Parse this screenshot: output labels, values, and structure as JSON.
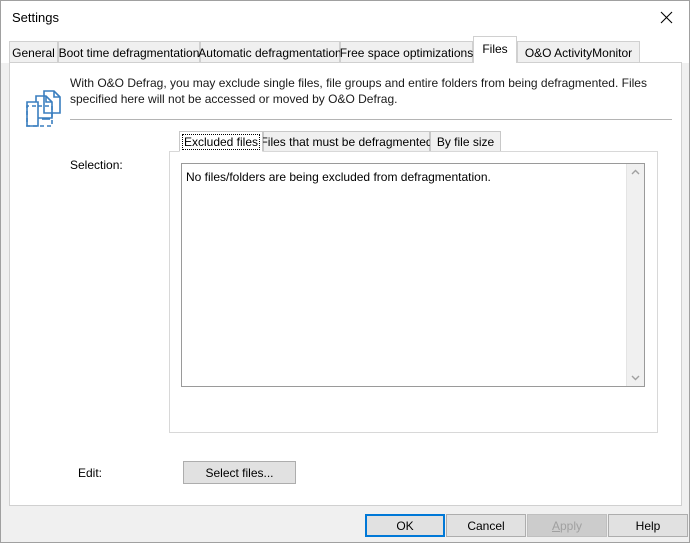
{
  "window": {
    "title": "Settings",
    "close_icon": "close-icon"
  },
  "outer_tabs": [
    {
      "label": "General",
      "selected": false
    },
    {
      "label": "Boot time defragmentation",
      "selected": false
    },
    {
      "label": "Automatic defragmentation",
      "selected": false
    },
    {
      "label": "Free space optimizations",
      "selected": false
    },
    {
      "label": "Files",
      "selected": true
    },
    {
      "label": "O&O ActivityMonitor",
      "selected": false
    }
  ],
  "content": {
    "icon_name": "excluded-files-icon",
    "description": "With O&O Defrag, you may exclude single files, file groups and entire folders from being defragmented. Files specified here will not be accessed or moved by O&O Defrag.",
    "selection_label": "Selection:",
    "edit_label": "Edit:",
    "select_files_button": "Select files..."
  },
  "inner_tabs": [
    {
      "label": "Excluded files",
      "selected": true
    },
    {
      "label": "Files that must be defragmented",
      "selected": false
    },
    {
      "label": "By file size",
      "selected": false
    }
  ],
  "listbox": {
    "empty_message": "No files/folders are being excluded from defragmentation.",
    "scroll_up_icon": "chevron-up-icon",
    "scroll_down_icon": "chevron-down-icon"
  },
  "footer": {
    "ok": "OK",
    "cancel": "Cancel",
    "apply_prefix": "A",
    "apply_rest": "pply",
    "help": "Help"
  },
  "colors": {
    "accent": "#0078d7",
    "icon_blue": "#3a7ebf",
    "dialog_bg": "#f0f0f0",
    "panel_bg": "#ffffff",
    "button_bg": "#e1e1e1",
    "disabled_text": "#a0a0a0"
  }
}
